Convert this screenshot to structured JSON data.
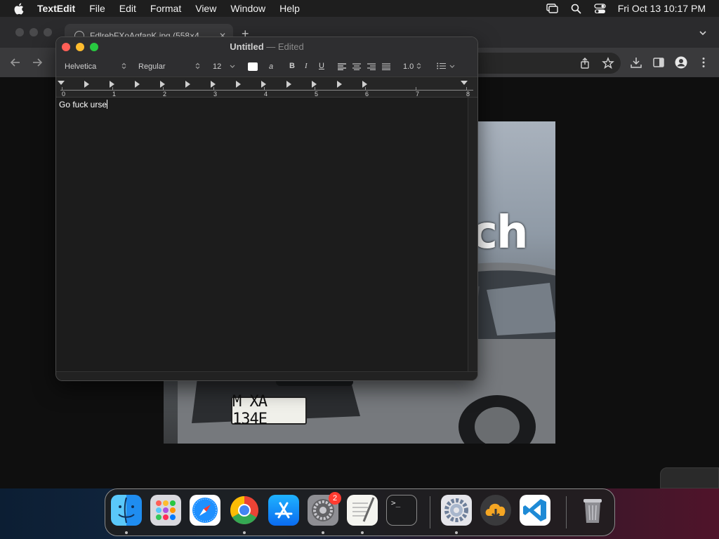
{
  "menubar": {
    "app_name": "TextEdit",
    "items": [
      "File",
      "Edit",
      "Format",
      "View",
      "Window",
      "Help"
    ],
    "clock": "Fri Oct 13  10:17 PM",
    "icons": [
      "apple-icon",
      "screen-mirroring-icon",
      "spotlight-search-icon",
      "control-center-icon"
    ]
  },
  "browser": {
    "tab_title": "FdlrebFXoAqfanK.jpg (558×4…",
    "tab_close": "✕",
    "new_tab": "+",
    "photo": {
      "overlay_text": "ch",
      "plate_text": "M XA 134E"
    }
  },
  "textedit": {
    "title_name": "Untitled",
    "title_sep": " — ",
    "title_state": "Edited",
    "font_family": "Helvetica",
    "font_style": "Regular",
    "font_size": "12",
    "highlight_glyph": "a",
    "bold": "B",
    "italic": "I",
    "underline": "U",
    "line_spacing": "1.0",
    "ruler_numbers": [
      "0",
      "1",
      "2",
      "3",
      "4",
      "5",
      "6",
      "7",
      "8"
    ],
    "document_text": "Go fuck urse"
  },
  "dock": {
    "apps": [
      {
        "name": "Finder",
        "icon": "finder-icon",
        "running": true
      },
      {
        "name": "Launchpad",
        "icon": "launchpad-icon",
        "running": false
      },
      {
        "name": "Safari",
        "icon": "safari-icon",
        "running": false
      },
      {
        "name": "Google Chrome",
        "icon": "chrome-icon",
        "running": true
      },
      {
        "name": "App Store",
        "icon": "app-store-icon",
        "running": false
      },
      {
        "name": "System Settings",
        "icon": "system-settings-icon",
        "running": true,
        "badge": "2"
      },
      {
        "name": "TextEdit",
        "icon": "textedit-icon",
        "running": true
      },
      {
        "name": "Terminal",
        "icon": "terminal-icon",
        "running": false
      },
      {
        "name": "System Preferences",
        "icon": "gear-icon",
        "running": true
      },
      {
        "name": "Downloader",
        "icon": "download-icon",
        "running": false
      },
      {
        "name": "Visual Studio Code",
        "icon": "vscode-icon",
        "running": false
      },
      {
        "name": "Trash",
        "icon": "trash-icon",
        "running": false
      }
    ],
    "terminal_prompt": ">_"
  },
  "colors": {
    "close": "#ff5f57",
    "minimize": "#febc2e",
    "zoom": "#28c840",
    "badge": "#ff3b30"
  }
}
